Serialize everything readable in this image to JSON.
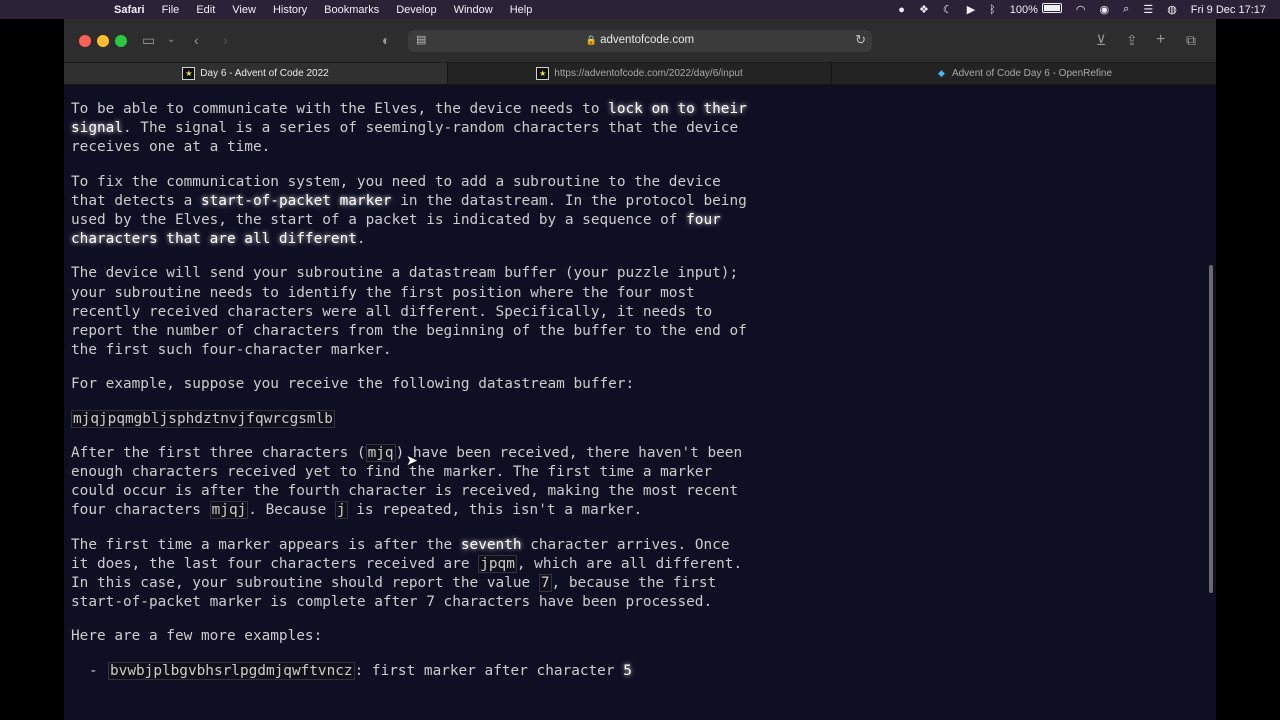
{
  "menubar": {
    "app": "Safari",
    "items": [
      "File",
      "Edit",
      "View",
      "History",
      "Bookmarks",
      "Develop",
      "Window",
      "Help"
    ],
    "battery": "100%",
    "clock": "Fri 9 Dec  17:17"
  },
  "browser": {
    "url": "adventofcode.com",
    "tabs": [
      {
        "label": "Day 6 - Advent of Code 2022",
        "active": true
      },
      {
        "label": "https://adventofcode.com/2022/day/6/input",
        "active": false
      },
      {
        "label": "Advent of Code Day 6 - OpenRefine",
        "active": false
      }
    ]
  },
  "article": {
    "p1": {
      "a": "To be able to communicate with the Elves, the device needs to ",
      "em": "lock on to their signal",
      "b": ". The signal is a series of seemingly-random characters that the device receives one at a time."
    },
    "p2": {
      "a": "To fix the communication system, you need to add a subroutine to the device that detects a ",
      "em1": "start-of-packet marker",
      "b": " in the datastream. In the protocol being used by the Elves, the start of a packet is indicated by a sequence of ",
      "em2": "four characters that are all different",
      "c": "."
    },
    "p3": "The device will send your subroutine a datastream buffer (your puzzle input); your subroutine needs to identify the first position where the four most recently received characters were all different. Specifically, it needs to report the number of characters from the beginning of the buffer to the end of the first such four-character marker.",
    "p4": "For example, suppose you receive the following datastream buffer:",
    "example": "mjqjpqmgbljsphdztnvjfqwrcgsmlb",
    "p5": {
      "a": "After the first three characters (",
      "code1": "mjq",
      "b": ") have been received, there haven't been enough characters received yet to find the marker. The first time a marker could occur is after the fourth character is received, making the most recent four characters ",
      "code2": "mjqj",
      "c": ". Because ",
      "code3": "j",
      "d": " is repeated, this isn't a marker."
    },
    "p6": {
      "a": "The first time a marker appears is after the ",
      "em": "seventh",
      "b": " character arrives. Once it does, the last four characters received are ",
      "code1": "jpqm",
      "c": ", which are all different. In this case, your subroutine should report the value ",
      "code2": "7",
      "d": ", because the first start-of-packet marker is complete after 7 characters have been processed."
    },
    "p7": "Here are a few more examples:",
    "examples": [
      {
        "code": "bvwbjplbgvbhsrlpgdmjqwftvncz",
        "text": ": first marker after character ",
        "value": "5"
      }
    ]
  },
  "colors": {
    "page_bg": "#0f0f23",
    "text": "#cccccc",
    "emphasis": "#ffffff",
    "menubar_bg": "#2b2237"
  }
}
